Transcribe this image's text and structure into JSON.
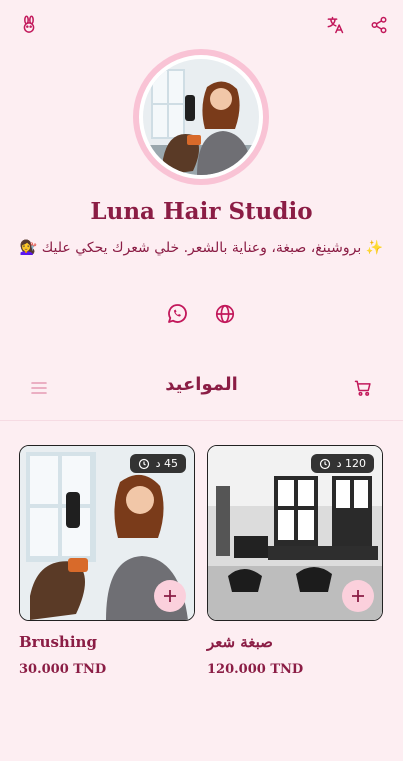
{
  "header": {
    "logo_icon": "bunny-icon",
    "translate_icon": "translate-icon",
    "share_icon": "share-icon"
  },
  "profile": {
    "name": "Luna Hair Studio",
    "tagline": "✨ بروشينغ، صبغة، وعناية بالشعر. خلي شعرك يحكي عليك 💇‍♀️"
  },
  "social": {
    "whatsapp_icon": "whatsapp-icon",
    "website_icon": "globe-icon"
  },
  "section": {
    "title": "المواعيد",
    "menu_icon": "menu-icon",
    "cart_icon": "cart-icon"
  },
  "services": [
    {
      "name": "Brushing",
      "price": "30.000 TND",
      "duration": "45 د"
    },
    {
      "name": "صبغة شعر",
      "price": "120.000 TND",
      "duration": "120 د"
    }
  ],
  "colors": {
    "background": "#fdeef2",
    "primary": "#8b1d45",
    "accent_soft": "#fbd0dc",
    "badge": "#333333"
  }
}
